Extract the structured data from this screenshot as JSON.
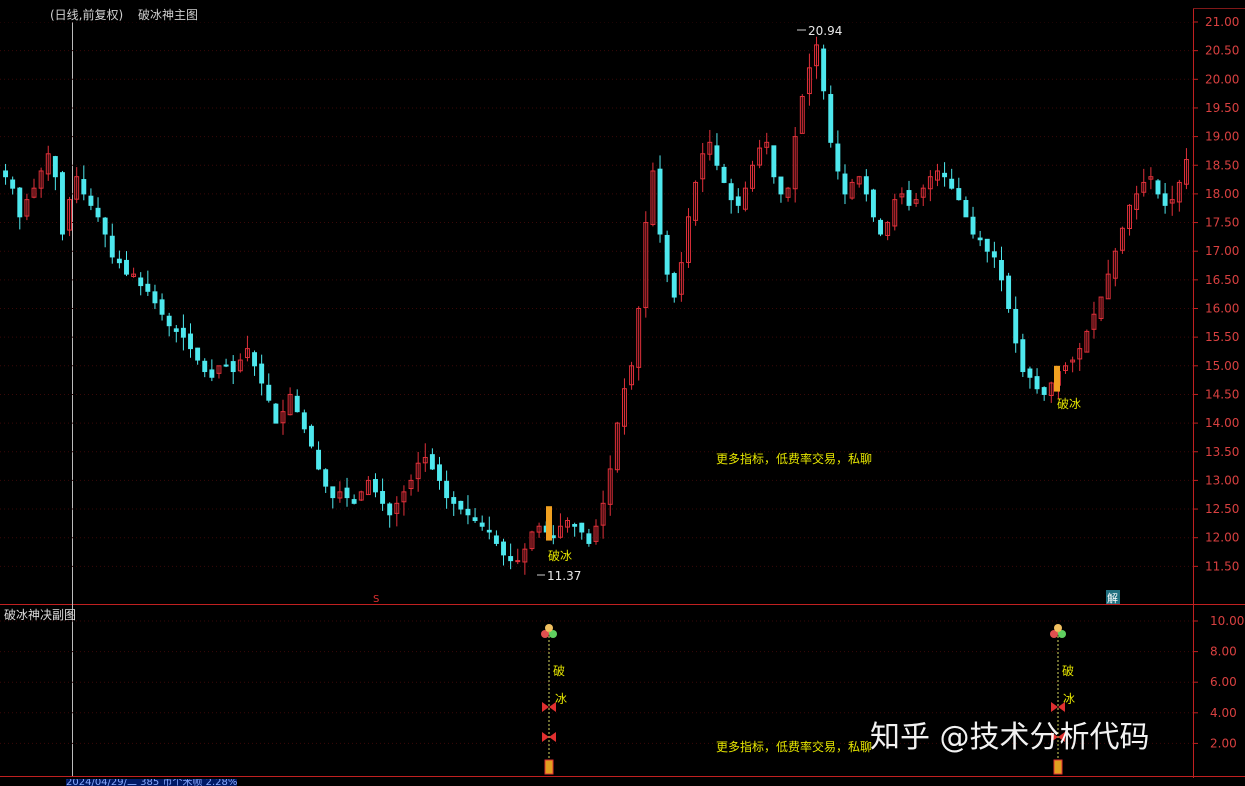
{
  "header": {
    "chart_title": "(日线,前复权)",
    "indicator_name": "破冰神主图"
  },
  "main_chart": {
    "y_axis_ticks": [
      "21.00",
      "20.50",
      "20.00",
      "19.50",
      "19.00",
      "18.50",
      "18.00",
      "17.50",
      "17.00",
      "16.50",
      "16.00",
      "15.50",
      "15.00",
      "14.50",
      "14.00",
      "13.50",
      "13.00",
      "12.50",
      "12.00",
      "11.50"
    ],
    "high_label": "20.94",
    "low_label": "11.37",
    "signal_label_1": "破冰",
    "signal_label_2": "破冰",
    "promo_text": "更多指标，低费率交易，私聊",
    "marker_s": "S",
    "marker_jie": "解"
  },
  "sub_chart": {
    "title": "破冰神决副图",
    "y_axis_ticks": [
      "10.00",
      "8.00",
      "6.00",
      "4.00",
      "2.00"
    ],
    "signal_char_1": "破",
    "signal_char_2": "冰",
    "promo_text": "更多指标，低费率交易，私聊"
  },
  "status_bar": {
    "text": "2024/04/29/二 385 币个米帧 2.28%"
  },
  "watermark": "知乎 @技术分析代码",
  "colors": {
    "up": "#e0303a",
    "down": "#4ee8ee",
    "signal": "#f0a020",
    "axis": "#c02020",
    "text_yellow": "#e6e600"
  },
  "chart_data": {
    "type": "candlestick",
    "ylim": [
      11.2,
      21.1
    ],
    "points": [
      18.3,
      18.1,
      17.6,
      17.9,
      18.1,
      18.4,
      18.7,
      18.3,
      17.3,
      17.9,
      18.3,
      18.0,
      17.8,
      17.6,
      17.3,
      16.9,
      16.8,
      16.6,
      16.6,
      16.4,
      16.3,
      16.1,
      15.9,
      15.7,
      15.6,
      15.5,
      15.3,
      15.1,
      14.9,
      14.8,
      15.0,
      15.0,
      14.9,
      15.1,
      15.3,
      15.0,
      14.7,
      14.4,
      14.0,
      14.2,
      14.5,
      14.2,
      13.9,
      13.6,
      13.2,
      12.9,
      12.7,
      12.8,
      12.7,
      12.6,
      12.8,
      13.0,
      12.8,
      12.6,
      12.4,
      12.6,
      12.8,
      13.0,
      13.3,
      13.4,
      13.2,
      13.0,
      12.7,
      12.6,
      12.5,
      12.4,
      12.3,
      12.2,
      12.1,
      11.9,
      11.7,
      11.6,
      11.6,
      11.8,
      12.1,
      12.2,
      12.1,
      12.0,
      12.2,
      12.3,
      12.2,
      12.1,
      11.9,
      12.2,
      12.6,
      13.2,
      14.0,
      14.6,
      15.0,
      16.0,
      17.5,
      18.4,
      17.3,
      16.6,
      16.2,
      16.8,
      17.6,
      18.2,
      18.7,
      18.9,
      18.5,
      18.2,
      17.9,
      17.8,
      18.1,
      18.5,
      18.8,
      18.9,
      18.3,
      18.0,
      18.1,
      19.0,
      19.7,
      20.2,
      20.6,
      19.8,
      18.9,
      18.4,
      18.0,
      18.2,
      18.3,
      18.0,
      17.6,
      17.3,
      17.5,
      17.9,
      18.0,
      17.8,
      17.9,
      18.1,
      18.3,
      18.4,
      18.3,
      18.1,
      17.9,
      17.6,
      17.3,
      17.2,
      17.0,
      16.9,
      16.5,
      16.0,
      15.4,
      14.9,
      14.8,
      14.6,
      14.5,
      14.7,
      14.9,
      15.0,
      15.1,
      15.3,
      15.6,
      15.9,
      16.2,
      16.6,
      17.0,
      17.4,
      17.8,
      18.0,
      18.2,
      18.3,
      18.0,
      17.8,
      17.9,
      18.2,
      18.6
    ]
  }
}
